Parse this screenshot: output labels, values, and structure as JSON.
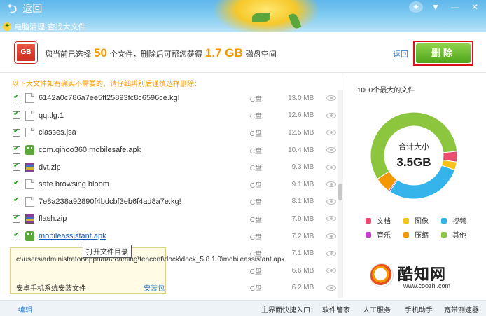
{
  "topbar": {
    "back_label": "返回",
    "crumb": "电脑清理-查找大文件",
    "logo_glyph": "+"
  },
  "window_controls": [
    {
      "name": "skin-icon",
      "glyph": "✦"
    },
    {
      "name": "menu-icon",
      "glyph": "▼"
    },
    {
      "name": "minimize-icon",
      "glyph": "—"
    },
    {
      "name": "close-icon",
      "glyph": "✕"
    }
  ],
  "summary": {
    "badge": "GB",
    "prefix": "您当前已选择",
    "count": "50",
    "middle": "个文件，删除后可帮您获得",
    "size": "1.7 GB",
    "suffix": "磁盘空间",
    "back_link": "返回",
    "delete_label": "删除"
  },
  "warning": "以下大文件如有确实不需要的，请仔细辨别后谨慎选择删除：",
  "files": [
    {
      "name": "6142a0c786a7ee5ff25893fc8c6596ce.kg!",
      "drive": "C盘",
      "size": "13.0 MB",
      "type": "doc"
    },
    {
      "name": "qq.tlg.1",
      "drive": "C盘",
      "size": "12.6 MB",
      "type": "doc"
    },
    {
      "name": "classes.jsa",
      "drive": "C盘",
      "size": "12.5 MB",
      "type": "doc"
    },
    {
      "name": "com.qihoo360.mobilesafe.apk",
      "drive": "C盘",
      "size": "10.4 MB",
      "type": "apk"
    },
    {
      "name": "dvt.zip",
      "drive": "C盘",
      "size": "9.3 MB",
      "type": "zip"
    },
    {
      "name": "safe browsing bloom",
      "drive": "C盘",
      "size": "9.1 MB",
      "type": "doc"
    },
    {
      "name": "7e8a238a92890f4bdcbf3eb6f4ad8a7e.kg!",
      "drive": "C盘",
      "size": "8.1 MB",
      "type": "doc"
    },
    {
      "name": "flash.zip",
      "drive": "C盘",
      "size": "7.9 MB",
      "type": "zip"
    },
    {
      "name": "mobileassistant.apk",
      "drive": "C盘",
      "size": "7.2 MB",
      "type": "apk",
      "link": true
    },
    {
      "name": "",
      "drive": "C盘",
      "size": "7.1 MB",
      "type": "none"
    },
    {
      "name": "",
      "drive": "C盘",
      "size": "6.6 MB",
      "type": "none"
    },
    {
      "name": "",
      "drive": "C盘",
      "size": "6.2 MB",
      "type": "none"
    }
  ],
  "tooltip": "打开文件目录",
  "popup": {
    "path": "c:\\users\\administrator\\appdata\\roaming\\tencent\\dock\\dock_5.8.1.0\\mobileassistant.apk",
    "title": "安卓手机系统安装文件",
    "link": "安装包"
  },
  "right_panel": {
    "title": "1000个最大的文件",
    "center_label": "合计大小",
    "center_value": "3.5GB"
  },
  "donut": [
    {
      "label": "文档",
      "value": 4,
      "color": "#e84c6f"
    },
    {
      "label": "图像",
      "value": 3,
      "color": "#f6c21a"
    },
    {
      "label": "视频",
      "value": 29,
      "color": "#34b4ea"
    },
    {
      "label": "音乐",
      "value": 0.5,
      "color": "#c53fd1"
    },
    {
      "label": "压缩",
      "value": 6,
      "color": "#f39800"
    },
    {
      "label": "其他",
      "value": 57.5,
      "color": "#8cc63f"
    }
  ],
  "bottom": {
    "edit": "编辑",
    "nav": [
      "主界面快捷入口：",
      "软件管家",
      "人工服务",
      "手机助手",
      "宽带测速器"
    ]
  },
  "watermark": {
    "brand": "酷知网",
    "url": "www.coozhi.com"
  }
}
